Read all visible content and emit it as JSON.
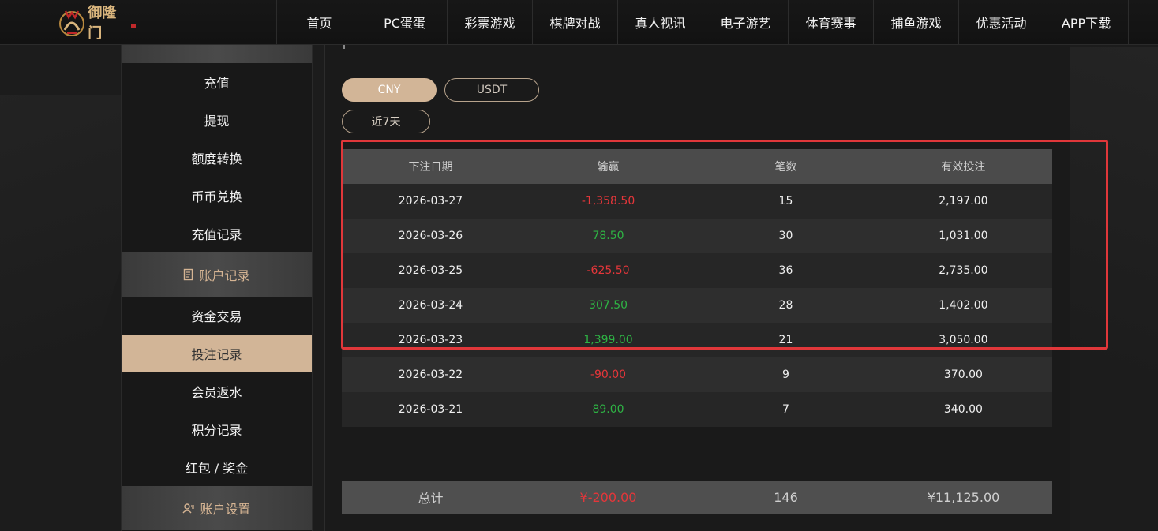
{
  "brand": {
    "name": "御隆门"
  },
  "nav": [
    "首页",
    "PC蛋蛋",
    "彩票游戏",
    "棋牌对战",
    "真人视讯",
    "电子游艺",
    "体育赛事",
    "捕鱼游戏",
    "优惠活动",
    "APP下载"
  ],
  "sidebar": {
    "funds_items": [
      "充值",
      "提现",
      "额度转换",
      "币币兑换",
      "充值记录"
    ],
    "records_header": "账户记录",
    "records_items": [
      "资金交易",
      "投注记录",
      "会员返水",
      "积分记录",
      "红包 / 奖金"
    ],
    "settings_header": "账户设置",
    "active_item": "投注记录"
  },
  "currency_tabs": {
    "selected": "CNY",
    "other": "USDT"
  },
  "range": "近7天",
  "table": {
    "headers": [
      "下注日期",
      "输赢",
      "笔数",
      "有效投注"
    ],
    "rows": [
      {
        "date": "2026-03-27",
        "winloss": "-1,358.50",
        "count": "15",
        "valid": "2,197.00",
        "sign": "neg"
      },
      {
        "date": "2026-03-26",
        "winloss": "78.50",
        "count": "30",
        "valid": "1,031.00",
        "sign": "pos"
      },
      {
        "date": "2026-03-25",
        "winloss": "-625.50",
        "count": "36",
        "valid": "2,735.00",
        "sign": "neg"
      },
      {
        "date": "2026-03-24",
        "winloss": "307.50",
        "count": "28",
        "valid": "1,402.00",
        "sign": "pos"
      },
      {
        "date": "2026-03-23",
        "winloss": "1,399.00",
        "count": "21",
        "valid": "3,050.00",
        "sign": "pos"
      },
      {
        "date": "2026-03-22",
        "winloss": "-90.00",
        "count": "9",
        "valid": "370.00",
        "sign": "neg"
      },
      {
        "date": "2026-03-21",
        "winloss": "89.00",
        "count": "7",
        "valid": "340.00",
        "sign": "pos"
      }
    ]
  },
  "total": {
    "label": "总计",
    "winloss": "¥-200.00",
    "count": "146",
    "valid": "¥11,125.00"
  },
  "colors": {
    "accent": "#d2b597",
    "negative": "#e5363a",
    "positive": "#2eb344",
    "highlight": "#e0373a"
  }
}
